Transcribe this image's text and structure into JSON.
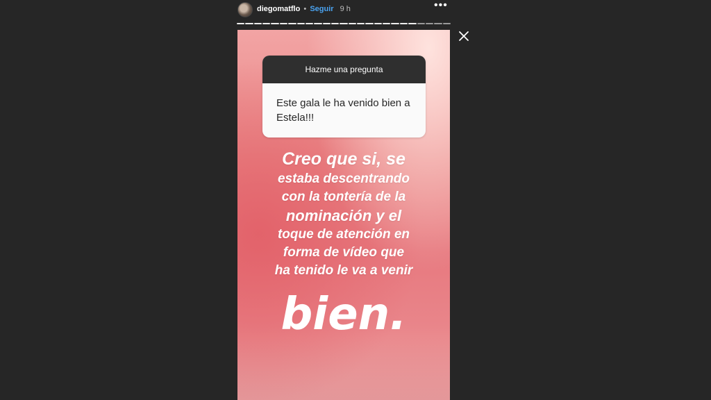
{
  "header": {
    "username": "diegomatflo",
    "separator": "•",
    "follow_label": "Seguir",
    "time": "9 h",
    "more_icon": "more-horizontal-icon"
  },
  "progress": {
    "total_segments": 25,
    "completed_segments": 21
  },
  "close_icon": "close-icon",
  "question": {
    "title": "Hazme una pregunta",
    "text": "Este gala le ha venido bien a Estela!!!"
  },
  "answer": {
    "lines": [
      "Creo que si, se",
      "estaba descentrando",
      "con la tontería de la",
      "nominación y el",
      "toque de atención en",
      "forma de vídeo que",
      "ha tenido le va a venir"
    ],
    "big": "bien."
  },
  "colors": {
    "background": "#262626",
    "follow": "#4aa3f0",
    "story_gradient_top": "#f2a4a4",
    "story_gradient_mid": "#e7797f"
  }
}
